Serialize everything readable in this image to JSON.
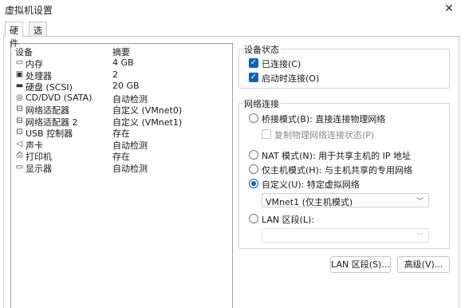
{
  "window": {
    "title": "虚拟机设置",
    "close_glyph": "✕"
  },
  "tabs": [
    {
      "label": "硬件"
    },
    {
      "label": "选项"
    }
  ],
  "device_list": {
    "col_device": "设备",
    "col_summary": "摘要",
    "rows": [
      {
        "icon": "memory-icon",
        "glyph": "▭",
        "name": "内存",
        "summary": "4 GB"
      },
      {
        "icon": "processor-icon",
        "glyph": "▣",
        "name": "处理器",
        "summary": "2"
      },
      {
        "icon": "hard-disk-icon",
        "glyph": "▬",
        "name": "硬盘 (SCSI)",
        "summary": "20 GB"
      },
      {
        "icon": "cd-dvd-icon",
        "glyph": "◎",
        "name": "CD/DVD (SATA)",
        "summary": "自动检测"
      },
      {
        "icon": "network-adapter-icon",
        "glyph": "⊟",
        "name": "网络适配器",
        "summary": "自定义 (VMnet0)"
      },
      {
        "icon": "network-adapter-icon",
        "glyph": "⊟",
        "name": "网络适配器 2",
        "summary": "自定义 (VMnet1)"
      },
      {
        "icon": "usb-controller-icon",
        "glyph": "⊡",
        "name": "USB 控制器",
        "summary": "存在"
      },
      {
        "icon": "sound-card-icon",
        "glyph": "◁",
        "name": "声卡",
        "summary": "自动检测"
      },
      {
        "icon": "printer-icon",
        "glyph": "⎙",
        "name": "打印机",
        "summary": "存在"
      },
      {
        "icon": "display-icon",
        "glyph": "▭",
        "name": "显示器",
        "summary": "自动检测"
      }
    ]
  },
  "device_status": {
    "title": "设备状态",
    "connected": {
      "label": "已连接(C)",
      "checked": true
    },
    "connect_on_start": {
      "label": "启动时连接(O)",
      "checked": true
    }
  },
  "network": {
    "title": "网络连接",
    "bridged": {
      "label": "桥接模式(B): 直接连接物理网络",
      "selected": false
    },
    "replicate": {
      "label": "复制物理网络连接状态(P)",
      "checked": false
    },
    "nat": {
      "label": "NAT 模式(N): 用于共享主机的 IP 地址",
      "selected": false
    },
    "host_only": {
      "label": "仅主机模式(H): 与主机共享的专用网络",
      "selected": false
    },
    "custom": {
      "label": "自定义(U): 特定虚拟网络",
      "selected": true
    },
    "custom_select_value": "VMnet1 (仅主机模式)",
    "lan_segment": {
      "label": "LAN 区段(L):",
      "selected": false
    },
    "lan_select_value": ""
  },
  "buttons": {
    "lan_segments": "LAN 区段(S)...",
    "advanced": "高级(V)..."
  },
  "chevron_glyph": "﹀",
  "check_glyph": "✓"
}
